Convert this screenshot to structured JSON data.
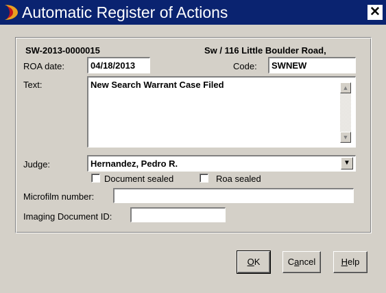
{
  "window": {
    "title": "Automatic Register of Actions",
    "close_glyph": "✕"
  },
  "case": {
    "number": "SW-2013-0000015",
    "description": "Sw / 116 Little Boulder Road,"
  },
  "roa_date": {
    "label": "ROA date:",
    "value": "04/18/2013"
  },
  "code": {
    "label": "Code:",
    "value": "SWNEW"
  },
  "text": {
    "label": "Text:",
    "value": "New Search Warrant Case Filed"
  },
  "judge": {
    "label": "Judge:",
    "value": "Hernandez, Pedro R."
  },
  "document_sealed": {
    "label": "Document sealed",
    "checked": false
  },
  "roa_sealed": {
    "label": "Roa sealed",
    "checked": false
  },
  "microfilm": {
    "label": "Microfilm number:",
    "value": ""
  },
  "imaging": {
    "label": "Imaging Document ID:",
    "value": ""
  },
  "buttons": {
    "ok": {
      "mnemonic": "O",
      "rest": "K"
    },
    "cancel": {
      "pre": "C",
      "mnemonic": "a",
      "rest": "ncel"
    },
    "help": {
      "mnemonic": "H",
      "rest": "elp"
    }
  },
  "icons": {
    "app": "app-logo-icon",
    "close": "close-icon",
    "scroll_up": "scroll-up-icon",
    "scroll_down": "scroll-down-icon",
    "dropdown": "chevron-down-icon"
  },
  "colors": {
    "titlebar": "#0a2370",
    "dialog": "#d4d0c8",
    "field": "#ffffff"
  }
}
